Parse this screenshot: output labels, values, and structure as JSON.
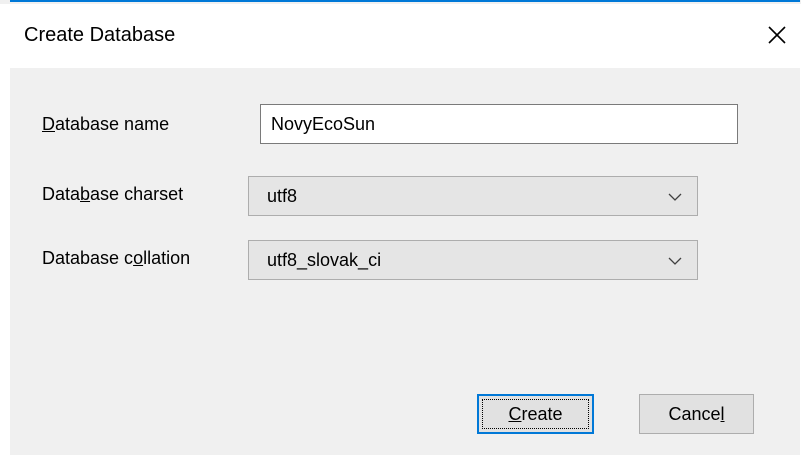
{
  "window": {
    "title": "Create Database",
    "accent_color": "#0078d7"
  },
  "form": {
    "name_label_mnemonic": "D",
    "name_label_rest": "atabase name",
    "name_value": "NovyEcoSun",
    "charset_label_pre": "Data",
    "charset_label_mnemonic": "b",
    "charset_label_post": "ase charset",
    "charset_value": "utf8",
    "collation_label_pre": "Database c",
    "collation_label_mnemonic": "o",
    "collation_label_post": "llation",
    "collation_value": "utf8_slovak_ci"
  },
  "buttons": {
    "create_mnemonic": "C",
    "create_rest": "reate",
    "cancel_pre": "Cance",
    "cancel_mnemonic": "l"
  },
  "icons": {
    "close": "close-icon",
    "dropdown": "chevron-down-icon"
  }
}
